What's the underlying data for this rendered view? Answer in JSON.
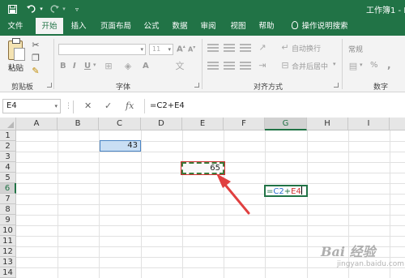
{
  "titlebar": {
    "save_icon": "save-icon",
    "undo_icon": "undo-icon",
    "redo_icon": "redo-icon",
    "customize_icon": "customize-qat-icon",
    "title": "工作簿1 - E"
  },
  "tabs": [
    {
      "label": "文件"
    },
    {
      "label": "开始"
    },
    {
      "label": "插入"
    },
    {
      "label": "页面布局"
    },
    {
      "label": "公式"
    },
    {
      "label": "数据"
    },
    {
      "label": "审阅"
    },
    {
      "label": "视图"
    },
    {
      "label": "帮助"
    },
    {
      "label": "操作说明搜索"
    }
  ],
  "ribbon": {
    "clipboard": {
      "paste_label": "粘贴",
      "group_label": "剪贴板"
    },
    "font": {
      "font_size": "11",
      "group_label": "字体"
    },
    "alignment": {
      "wrap_label": "自动换行",
      "merge_label": "合并后居中",
      "group_label": "对齐方式"
    },
    "number": {
      "format": "常规",
      "percent": "%",
      "group_label": "数字"
    }
  },
  "formula_bar": {
    "name_box": "E4",
    "cancel": "✕",
    "enter": "✓",
    "fx": "fx",
    "formula": "=C2+E4"
  },
  "grid": {
    "columns": [
      "A",
      "B",
      "C",
      "D",
      "E",
      "F",
      "G",
      "H",
      "I"
    ],
    "rows": [
      "1",
      "2",
      "3",
      "4",
      "5",
      "6",
      "7",
      "8",
      "9",
      "10",
      "11",
      "12",
      "13",
      "14"
    ],
    "active_column": "G",
    "active_row": "6"
  },
  "cells": {
    "C2": "43",
    "E4": "65",
    "G6": {
      "eq": "=",
      "ref1": "C2",
      "op": "+",
      "ref2": "E4"
    }
  },
  "colors": {
    "excel_green": "#217346",
    "ref_blue": "#2f6fd0",
    "ref_red": "#d03030",
    "arrow_red": "#e04040"
  },
  "watermark": {
    "text": "Bai 经验",
    "sub": "jingyan.baidu.com"
  }
}
